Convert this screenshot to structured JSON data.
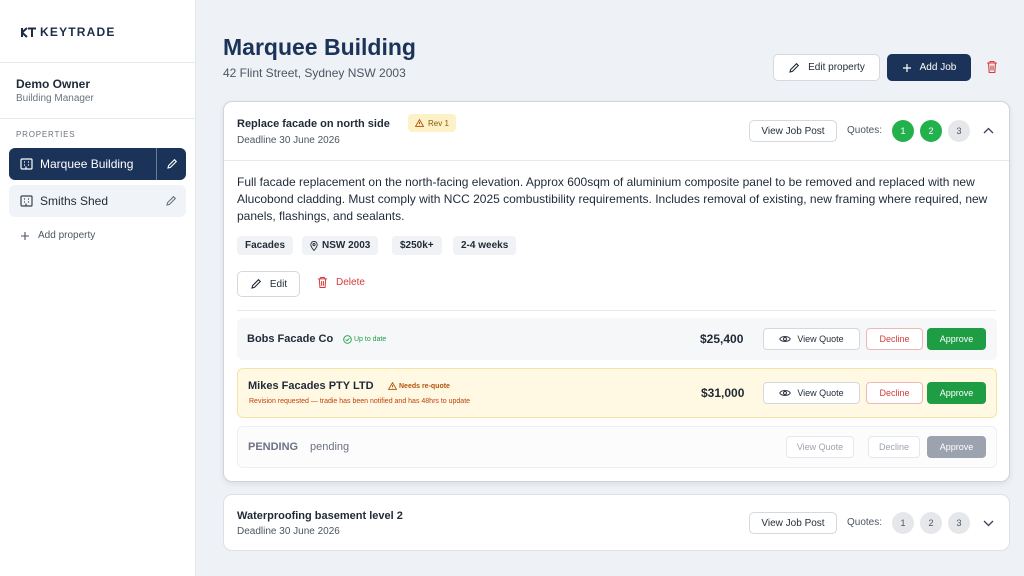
{
  "brand": {
    "logo_text": "KEYTRADE"
  },
  "user": {
    "name": "Demo Owner",
    "role": "Building Manager"
  },
  "sidebar": {
    "section_label": "PROPERTIES",
    "properties": [
      {
        "label": "Marquee Building",
        "active": true
      },
      {
        "label": "Smiths Shed",
        "active": false
      }
    ],
    "add_label": "Add property"
  },
  "header": {
    "title": "Marquee Building",
    "address": "42 Flint Street, Sydney NSW 2003",
    "edit_label": "Edit property",
    "add_job_label": "Add Job"
  },
  "jobs": [
    {
      "title": "Replace facade on north side",
      "badge": "Rev 1",
      "deadline": "Deadline 30 June 2026",
      "view_post_label": "View Job Post",
      "quotes_label": "Quotes:",
      "quote_counts": [
        "1",
        "2",
        "3"
      ],
      "description": "Full facade replacement on the north-facing elevation. Approx 600sqm of aluminium composite panel to be removed and replaced with new Alucobond cladding. Must comply with NCC 2025 combustibility requirements. Includes removal of existing, new framing where required, new panels, flashings, and sealants.",
      "tags": [
        "Facades",
        "NSW 2003",
        "$250k+",
        "2-4 weeks"
      ],
      "edit_label": "Edit",
      "delete_label": "Delete",
      "quotes": [
        {
          "tradie": "Bobs Facade Co",
          "status": "Up to date",
          "price": "$25,400",
          "view": "View Quote",
          "decline": "Decline",
          "approve": "Approve"
        },
        {
          "tradie": "Mikes Facades PTY LTD",
          "status": "Needs re-quote",
          "note": "Revision requested — tradie has been notified and has 48hrs to update",
          "price": "$31,000",
          "view": "View Quote",
          "decline": "Decline",
          "approve": "Approve"
        },
        {
          "tradie": "PENDING",
          "status": "pending",
          "view": "View Quote",
          "decline": "Decline",
          "approve": "Approve"
        }
      ]
    },
    {
      "title": "Waterproofing basement level 2",
      "deadline": "Deadline 30 June 2026",
      "view_post_label": "View Job Post",
      "quotes_label": "Quotes:",
      "quote_counts": [
        "1",
        "2",
        "3"
      ]
    }
  ],
  "colors": {
    "brand_navy": "#1b3358",
    "approve_green": "#1f9d45",
    "decline_red": "#d63b3b",
    "warn_bg": "#fff8e3"
  }
}
